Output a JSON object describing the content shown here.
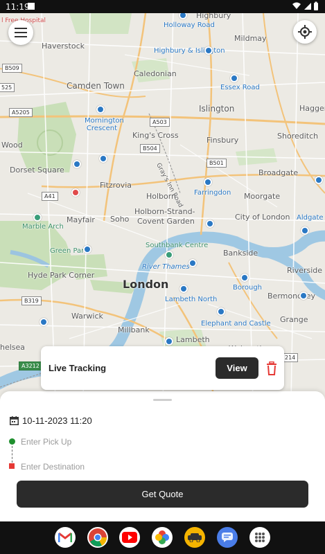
{
  "status_bar": {
    "time": "11:19"
  },
  "map": {
    "labels": {
      "free_hospital": "l Free Hospital",
      "highbury": "Highbury",
      "holloway_road": "Holloway Road",
      "haverstock": "Haverstock",
      "mildmay": "Mildmay",
      "highbury_islington": "Highbury & Islington",
      "caledonian": "Caledonian",
      "essex_road": "Essex Road",
      "camden_town": "Camden Town",
      "islington": "Islington",
      "haggers": "Haggers",
      "mornington_crescent": "Mornington Crescent",
      "kings_cross": "King's Cross",
      "finsbury": "Finsbury",
      "shoreditch": "Shoreditch",
      "wood": "Wood",
      "dorset_square": "Dorset Square",
      "grays_inn_road": "Gray's Inn Road",
      "broadgate": "Broadgate",
      "fitzrovia": "Fitzrovia",
      "farringdon": "Farringdon",
      "holborn": "Holborn",
      "moorgate": "Moorgate",
      "marble_arch": "Marble Arch",
      "mayfair": "Mayfair",
      "soho": "Soho",
      "holborn_strand": "Holborn-Strand-",
      "covent_garden": "Covent Garden",
      "city_of_london": "City of London",
      "aldgate_east": "Aldgate Ea",
      "green_park": "Green Park",
      "southbank_centre": "Southbank Centre",
      "bankside": "Bankside",
      "hyde_park_corner": "Hyde Park Corner",
      "river_thames": "River Thames",
      "riverside": "Riverside",
      "london": "London",
      "borough": "Borough",
      "bermondsey": "Bermondsey",
      "lambeth_north": "Lambeth North",
      "warwick": "Warwick",
      "grange": "Grange",
      "elephant_castle": "Elephant and Castle",
      "millbank": "Millbank",
      "lambeth": "Lambeth",
      "helsea": "helsea",
      "walworth": "Walworth"
    },
    "road_badges": {
      "b509": "B509",
      "b525": "525",
      "a5205": "A5205",
      "a503": "A503",
      "b504": "B504",
      "b501": "B501",
      "a41": "A41",
      "b319": "B319",
      "a3212": "A3212",
      "b214": "214"
    }
  },
  "menu_icon": "hamburger-menu-icon",
  "locate_icon": "gps-locate-icon",
  "tracking_card": {
    "title": "Live Tracking",
    "view_label": "View",
    "delete_icon": "trash-icon",
    "delete_color": "#e53935"
  },
  "booking": {
    "datetime": "10-11-2023 11:20",
    "pickup_placeholder": "Enter Pick Up",
    "destination_placeholder": "Enter Destination",
    "quote_label": "Get Quote",
    "pickup_color": "#1f8f2e",
    "destination_color": "#e53935"
  },
  "dock": {
    "apps": [
      "gmail-icon",
      "chrome-icon",
      "youtube-icon",
      "photos-icon",
      "taxi-app-icon",
      "messages-icon",
      "app-drawer-icon"
    ]
  }
}
